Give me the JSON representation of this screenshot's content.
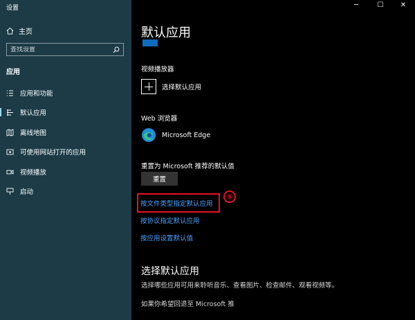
{
  "window": {
    "title": "设置",
    "controls": {
      "minimize": "─",
      "maximize": "☐",
      "close": "✕"
    }
  },
  "sidebar": {
    "home_label": "主页",
    "search_placeholder": "查找设置",
    "section_title": "应用",
    "items": [
      {
        "label": "应用和功能",
        "icon": "apps-features-icon"
      },
      {
        "label": "默认应用",
        "icon": "default-apps-icon",
        "active": true
      },
      {
        "label": "离线地图",
        "icon": "offline-maps-icon"
      },
      {
        "label": "可使用网站打开的应用",
        "icon": "apps-for-websites-icon"
      },
      {
        "label": "视频播放",
        "icon": "video-playback-icon"
      },
      {
        "label": "启动",
        "icon": "startup-icon"
      }
    ]
  },
  "main": {
    "title": "默认应用",
    "video_player": {
      "label": "视频播放器",
      "app": "选择默认应用"
    },
    "web_browser": {
      "label": "Web 浏览器",
      "app": "Microsoft Edge"
    },
    "reset": {
      "label": "重置为 Microsoft 推荐的默认值",
      "button": "重置"
    },
    "links": [
      "按文件类型指定默认应用",
      "按协议指定默认应用",
      "按应用设置默认值"
    ],
    "annotation_number": "⑤",
    "choose_section": {
      "title": "选择默认应用",
      "description": "选择哪些应用可用来聆听音乐、查看图片、检查邮件、观看视频等。",
      "partial_text": "如果你希望回退至 Microsoft 推"
    }
  },
  "colors": {
    "sidebar_bg": "#1c3b47",
    "main_bg": "#000000",
    "link": "#4aa3ff",
    "highlight": "#e81123"
  }
}
